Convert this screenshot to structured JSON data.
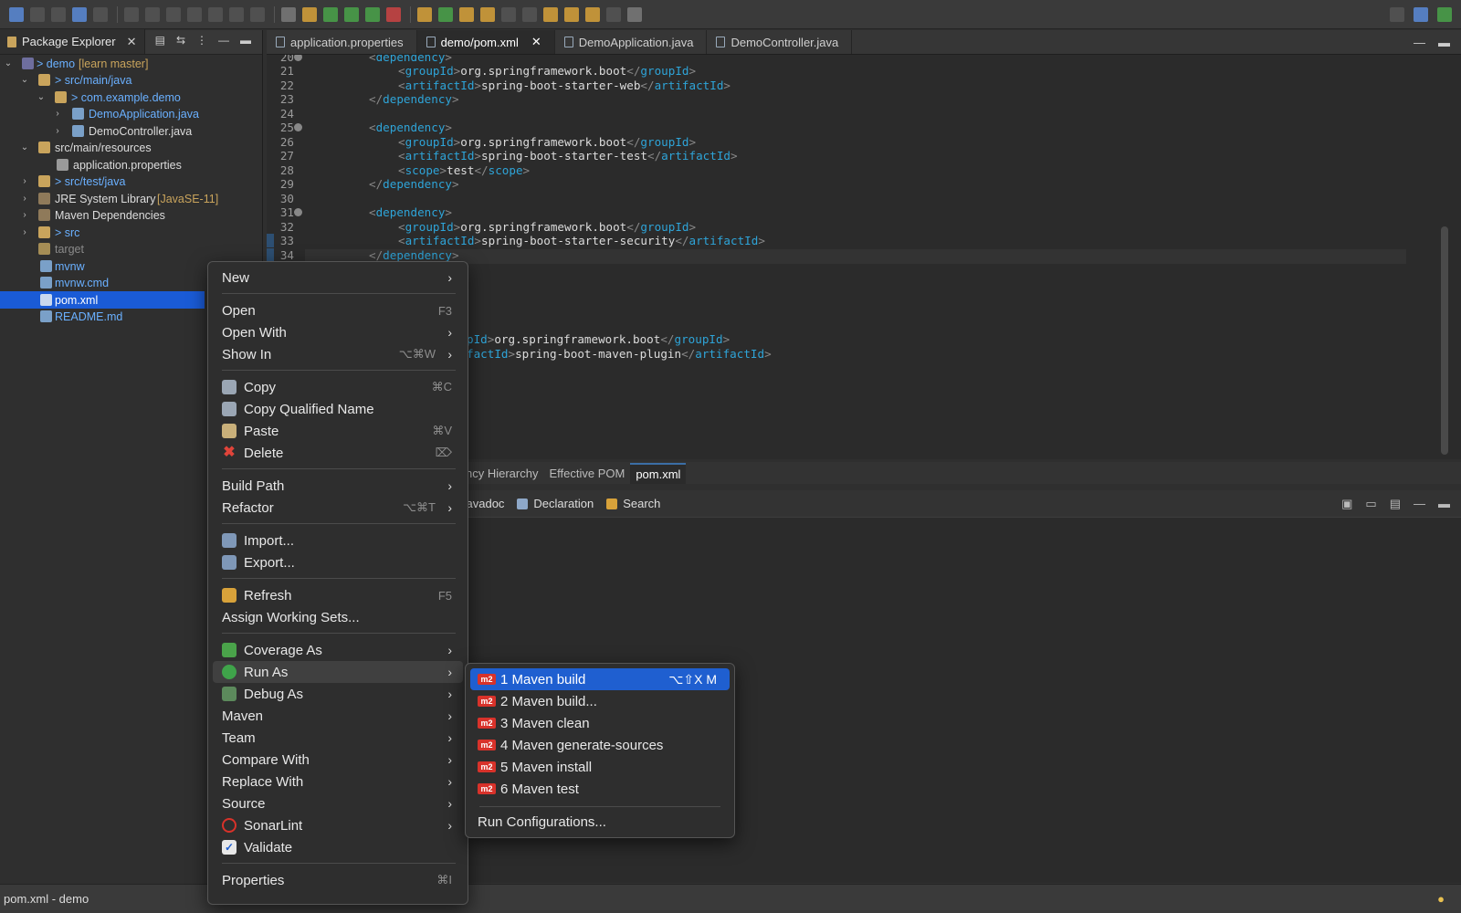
{
  "package_explorer": {
    "title": "Package Explorer",
    "tree": [
      {
        "label": "> demo",
        "suffix": " [learn master]"
      },
      {
        "label": "> src/main/java"
      },
      {
        "label": "> com.example.demo"
      },
      {
        "label": "DemoApplication.java"
      },
      {
        "label": "DemoController.java"
      },
      {
        "label": "src/main/resources"
      },
      {
        "label": "application.properties"
      },
      {
        "label": "> src/test/java"
      },
      {
        "label": "JRE System Library",
        "suffix": " [JavaSE-11]"
      },
      {
        "label": "Maven Dependencies"
      },
      {
        "label": "> src"
      },
      {
        "label": "target"
      },
      {
        "label": "mvnw"
      },
      {
        "label": "mvnw.cmd"
      },
      {
        "label": "pom.xml"
      },
      {
        "label": "README.md"
      }
    ]
  },
  "editor": {
    "tabs": [
      "application.properties",
      "demo/pom.xml",
      "DemoApplication.java",
      "DemoController.java"
    ],
    "line_numbers": [
      "20",
      "21",
      "22",
      "23",
      "24",
      "25",
      "26",
      "27",
      "28",
      "29",
      "30",
      "31",
      "32",
      "33",
      "34"
    ],
    "pom_tabs": [
      "ncy Hierarchy",
      "Effective POM",
      "pom.xml"
    ]
  },
  "code": {
    "dep_open": "dependency",
    "groupId": "groupId",
    "artifactId": "artifactId",
    "scope": "scope",
    "boot": "org.springframework.boot",
    "web": "spring-boot-starter-web",
    "test_starter": "spring-boot-starter-test",
    "test": "test",
    "security": "spring-boot-starter-security",
    "plugin": "spring-boot-maven-plugin",
    "partial_group": "pId",
    "partial_artifact": "factId"
  },
  "bottom_panel": {
    "tabs": [
      "Javadoc",
      "Declaration",
      "Search"
    ]
  },
  "status_bar": {
    "text": "pom.xml - demo"
  },
  "context_menu": {
    "items": {
      "new": "New",
      "open": "Open",
      "open_sc": "F3",
      "open_with": "Open With",
      "show_in": "Show In",
      "show_in_sc": "⌥⌘W",
      "copy": "Copy",
      "copy_sc": "⌘C",
      "copy_qn": "Copy Qualified Name",
      "paste": "Paste",
      "paste_sc": "⌘V",
      "delete": "Delete",
      "delete_sc": "⌦",
      "build_path": "Build Path",
      "refactor": "Refactor",
      "refactor_sc": "⌥⌘T",
      "import": "Import...",
      "export": "Export...",
      "refresh": "Refresh",
      "refresh_sc": "F5",
      "assign_ws": "Assign Working Sets...",
      "coverage": "Coverage As",
      "run_as": "Run As",
      "debug_as": "Debug As",
      "maven": "Maven",
      "team": "Team",
      "compare": "Compare With",
      "replace": "Replace With",
      "source": "Source",
      "sonarlint": "SonarLint",
      "validate": "Validate",
      "properties": "Properties",
      "properties_sc": "⌘I"
    }
  },
  "run_as_submenu": {
    "badge": "m2",
    "items": [
      "1 Maven build",
      "2 Maven build...",
      "3 Maven clean",
      "4 Maven generate-sources",
      "5 Maven install",
      "6 Maven test"
    ],
    "shortcut": "⌥⇧X M",
    "configs": "Run Configurations..."
  }
}
